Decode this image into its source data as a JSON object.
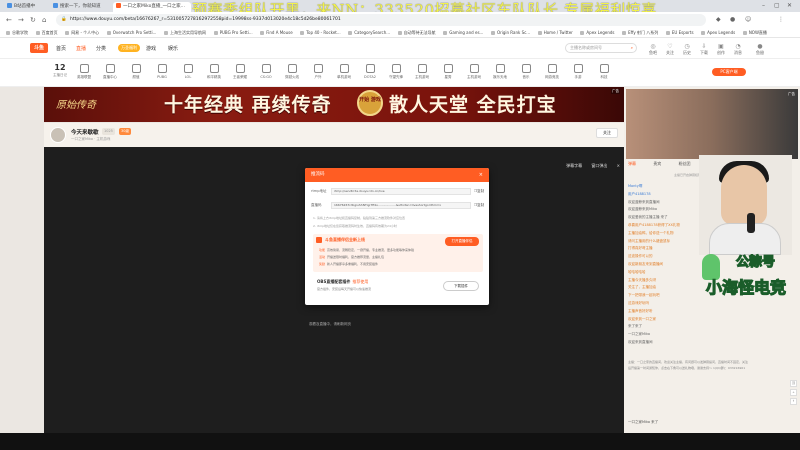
{
  "browser": {
    "tabs": [
      {
        "label": "B站首播中",
        "color": "#4a90e2"
      },
      {
        "label": "搜索一下，你就知道",
        "color": "#4a90e2"
      },
      {
        "label": "一口之家Miko直播_一口之家...",
        "color": "#ff5d23"
      }
    ],
    "url": "https://www.douyu.com/beta/16676267_r=5310057278162972558pid=19998ss-9337d013020e4c18c5d26be80061701",
    "bookmarks": [
      "谷歌学院",
      "百度首页",
      "网易 - 个人中心",
      "Overwatch Pro Setti...",
      "上海生活实用导航网",
      "PUBG Pro Setti...",
      "Find A Mouse",
      "Top 40 - Rocket...",
      "CategorySearch...",
      "自动等待无法导航",
      "Gaming and es...",
      "Origin Rank Sc...",
      "Home / Twitter",
      "Apex Legends",
      "Effy 射门 八系列",
      "EU Esports",
      "Apex Legends",
      "NOW直播"
    ]
  },
  "marquee": "预赛季组队开黑，来NN：333520招募社区车队队长,专属福利惊喜",
  "site": {
    "logo": "斗鱼",
    "nav": [
      "首页",
      "直播",
      "分类",
      "游戏",
      "娱乐",
      "赛事"
    ],
    "promo": "万圣福利",
    "search_placeholder": "主播名称或房间号",
    "header_icons": [
      "鱼吧",
      "关注",
      "历史",
      "下载",
      "创作",
      "消息",
      "鱼翅"
    ],
    "date": {
      "num": "12",
      "label": "主播日记"
    },
    "categories": [
      "英雄联盟",
      "直播中心",
      "颜值",
      "PUBG",
      "LOL",
      "和平精英",
      "王者荣耀",
      "CS:GO",
      "穿越火线",
      "户外",
      "单机游戏",
      "DOTA2",
      "守望先锋",
      "主机游戏",
      "星秀",
      "主机游戏",
      "娱乐天地",
      "音乐",
      "网游竞技",
      "手游",
      "科技"
    ],
    "pc_button": "PC客户端"
  },
  "banner": {
    "brand": "原始传奇",
    "slogan_left": "十年经典 再续传奇",
    "start": "开始 游戏",
    "slogan_right": "散人天堂 全民打宝",
    "ad": "广告"
  },
  "room": {
    "title": "今天来歇歇",
    "tags": [
      "1025",
      "30级"
    ],
    "sub": "一口之家Miko · 主机游戏",
    "follow_label": "关注"
  },
  "player": {
    "controls": [
      "弹幕字幕",
      "窗口弹出",
      "×"
    ],
    "hint": "观看及直播中，请刷新网页"
  },
  "dialog": {
    "title": "推流码",
    "close": "×",
    "rows": [
      {
        "label": "rtmp地址",
        "value": "rtmp://sendtc3a.douyucdn.cn/live",
        "copy": "复制"
      },
      {
        "label": "直播码",
        "value": "16676267rdbgiuShNTqjrHf4u...................&ufkxtsn=liveshortgorithm=x",
        "copy": "复制"
      }
    ],
    "notes": [
      "1. 请将上方rtmp地址和直播码复制，粘贴到第三方推流软件对应位置",
      "2. rtmp地址仅在您获取推流码时生效，直播码有效期为24小时"
    ],
    "promo": {
      "title": "斗鱼直播伴侣全新上线",
      "button": "打开直播伴侣",
      "lines": [
        {
          "tag": "功能",
          "text": "高效简易、流畅稳定，一键开播，专业推流，更多功能等你来体验"
        },
        {
          "tag": "活动",
          "text": "开播送限时福利，官方推荐流量，主播礼包"
        },
        {
          "tag": "奖励",
          "text": "新人开播即享多重福利，不用安装插件"
        }
      ]
    },
    "obs": {
      "title": "OBS直播配套插件",
      "recommend": "推荐使用",
      "desc": "官方插件，安装后每天开播可以快速推流",
      "button": "下载插件"
    }
  },
  "sidebar": {
    "ad_tag": "广告",
    "tabs": [
      "弹幕",
      "贵宾",
      "粉丝团"
    ],
    "tip": "主播已开启弹幕权限",
    "messages": [
      {
        "user": "Monty啊",
        "text": ""
      },
      {
        "user": "用户4188178",
        "text": ""
      },
      {
        "user": "",
        "text": "欢迎蓝鲸来到直播间"
      },
      {
        "user": "",
        "text": "欢迎蓝鲸来到Miko"
      },
      {
        "user": "",
        "text": "欢迎爱我的主播主播 来了"
      },
      {
        "user": "",
        "text": "恭喜用户4188178获得了XX礼物",
        "orange": true
      },
      {
        "user": "",
        "text": "主播加油鸭，给你送一个礼物",
        "orange": true
      },
      {
        "user": "",
        "text": "请问主播用的什么键盘鼠标",
        "orange": true
      },
      {
        "user": "",
        "text": "打得真好呀主播",
        "orange": true
      },
      {
        "user": "",
        "text": "这波操作可以的",
        "orange": true
      },
      {
        "user": "",
        "text": "欢迎新朋友来到直播间",
        "orange": true
      },
      {
        "user": "",
        "text": "哈哈哈哈哈",
        "orange": true
      },
      {
        "user": "",
        "text": "主播今天播多久呀",
        "orange": true
      },
      {
        "user": "",
        "text": "关注了，主播加油",
        "orange": true
      },
      {
        "user": "",
        "text": "下一把带我一起玩吧",
        "orange": true
      },
      {
        "user": "",
        "text": "这游戏好玩吗",
        "orange": true
      },
      {
        "user": "",
        "text": "主播声音好好听",
        "orange": true
      },
      {
        "user": "",
        "text": "欢迎来到一口之家",
        "orange": true
      },
      {
        "user": "",
        "text": "来了来了"
      },
      {
        "user": "",
        "text": "一口之家Miko"
      },
      {
        "user": "",
        "text": "欢迎来到直播间"
      }
    ],
    "long_text": "主播：一口之家的直播间，欢迎关注主播，有问题可以发弹幕提问，直播时间不固定，关注后开播第一时间通知你，点击右下角可以送礼物哦，谢谢支持～ 1(QQ群)：933216961",
    "fans": "一口之家Miko 来了",
    "side_buttons": [
      "顶",
      "+",
      "↑"
    ]
  },
  "cam": {
    "watermark_1": "公粽号",
    "watermark_2": "小海怪电竞"
  }
}
